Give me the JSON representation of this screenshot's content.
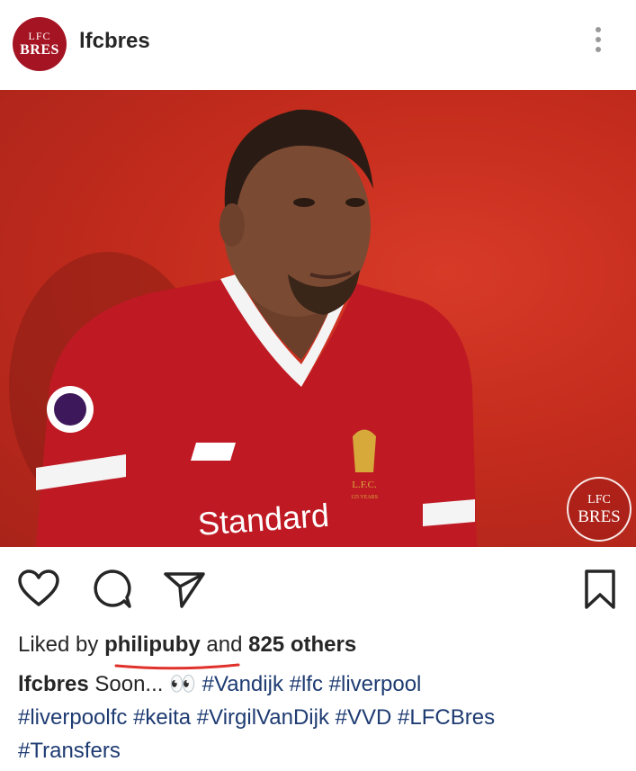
{
  "post": {
    "avatar_line1": "LFC",
    "avatar_line2": "BRES",
    "username": "lfcbres",
    "more_icon": "more-vertical-icon"
  },
  "image": {
    "watermark_line1": "LFC",
    "watermark_line2": "BRES",
    "shirt_sponsor": "Standard",
    "crest_text": "L.F.C.",
    "crest_sub": "125 YEARS"
  },
  "actions": {
    "like_icon": "heart-icon",
    "comment_icon": "comment-icon",
    "share_icon": "send-icon",
    "save_icon": "bookmark-icon"
  },
  "likes": {
    "prefix": "Liked by",
    "user": "philipuby",
    "middle": "and",
    "others": "825 others",
    "underline_color": "#e0312b"
  },
  "caption": {
    "username": "lfcbres",
    "text": "Soon... 👀",
    "hashtags": [
      "#Vandijk",
      "#lfc",
      "#liverpool",
      "#liverpoolfc",
      "#keita",
      "#VirgilVanDijk",
      "#VVD",
      "#LFCBres",
      "#Transfers"
    ]
  },
  "colors": {
    "brand_red": "#a51422",
    "hashtag": "#1e3b72",
    "text": "#262626"
  }
}
